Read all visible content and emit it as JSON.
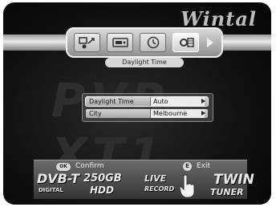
{
  "brand": "Wintal",
  "watermark": "PVR-XT1",
  "menu": {
    "icons": [
      {
        "name": "setup-icon"
      },
      {
        "name": "recording-icon"
      },
      {
        "name": "timer-icon"
      },
      {
        "name": "settings-icon"
      }
    ],
    "more_arrow": "right-arrow-icon"
  },
  "title": "Daylight Time",
  "settings": [
    {
      "label": "Daylight Time",
      "value": "Auto"
    },
    {
      "label": "City",
      "value": "Melbourne"
    }
  ],
  "hints": {
    "confirm_key": "OK",
    "confirm_label": "Confirm",
    "exit_key": "E",
    "exit_label": "Exit"
  },
  "logos": {
    "dvb": "DVB-T",
    "dvb_sub": "DIGITAL",
    "hdd": "250GB",
    "hdd_sub": "HDD",
    "live": "LIVE",
    "record": "RECORD",
    "twin": "TWIN",
    "tuner": "TUNER"
  },
  "colors": {
    "background": "#121212",
    "bar": "#d0d0d0",
    "text": "#eeeeee"
  }
}
